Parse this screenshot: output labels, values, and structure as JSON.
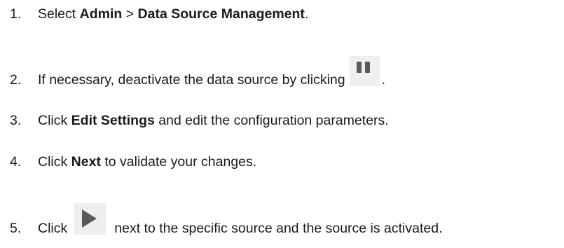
{
  "steps": [
    {
      "number": "1.",
      "pre": "Select ",
      "bold1": "Admin",
      "mid": " > ",
      "bold2": "Data Source Management",
      "post": "."
    },
    {
      "number": "2.",
      "pre": "If necessary, deactivate the data source by clicking",
      "icon": "pause-icon",
      "post": "."
    },
    {
      "number": "3.",
      "pre": "Click ",
      "bold1": "Edit Settings",
      "post": " and edit the configuration parameters."
    },
    {
      "number": "4.",
      "pre": "Click ",
      "bold1": "Next",
      "post": " to validate your changes."
    },
    {
      "number": "5.",
      "pre": "Click",
      "icon": "play-icon",
      "post": "next to the specific source and the source is activated."
    }
  ]
}
